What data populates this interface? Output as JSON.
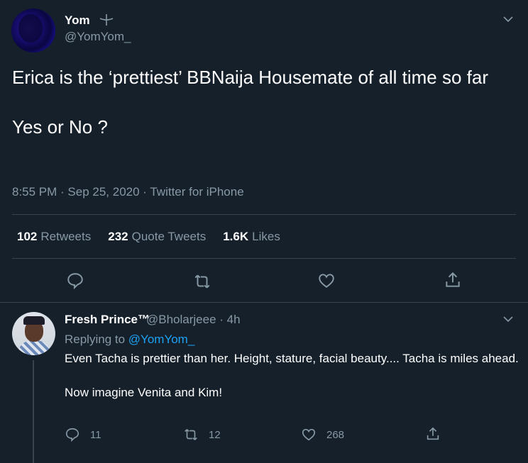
{
  "tweet": {
    "author_name": "Yom",
    "author_handle": "@YomYom_",
    "text_line1": "Erica is the ‘prettiest’ BBNaija Housemate of all time so far",
    "text_line2": "Yes or No ?",
    "meta": "8:55 PM · Sep 25, 2020 · Twitter for iPhone",
    "stats": {
      "retweets_count": "102",
      "retweets_label": "Retweets",
      "quotes_count": "232",
      "quotes_label": "Quote Tweets",
      "likes_count": "1.6K",
      "likes_label": "Likes"
    }
  },
  "reply": {
    "author_name": "Fresh Prince™",
    "author_handle": "@Bholarjeee · 4h",
    "replying_prefix": "Replying to",
    "replying_to": "@YomYom_",
    "text_p1": "Even Tacha is prettier than her. Height, stature, facial beauty.... Tacha is miles ahead.",
    "text_p2": "Now imagine Venita and Kim!",
    "reply_count": "11",
    "retweet_count": "12",
    "like_count": "268"
  },
  "colors": {
    "background": "#15202b",
    "secondary_text": "#8899a6",
    "link": "#1da1f2",
    "divider": "#38444d"
  },
  "icons": [
    "verified-glyph-icon",
    "chevron-down-icon",
    "reply-icon",
    "retweet-icon",
    "like-icon",
    "share-icon"
  ]
}
